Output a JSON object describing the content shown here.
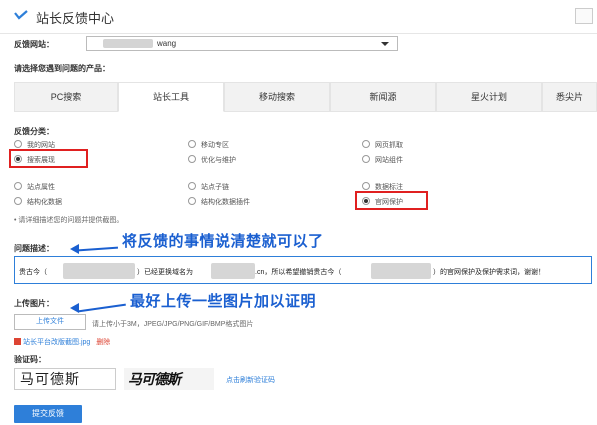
{
  "header": {
    "title": "站长反馈中心",
    "logo_icon": "check-chevron-icon"
  },
  "site": {
    "label": "反馈网站：",
    "value": "wang"
  },
  "product_prompt": "请选择您遇到问题的产品：",
  "tabs": [
    {
      "label": "PC搜索"
    },
    {
      "label": "站长工具"
    },
    {
      "label": "移动搜索"
    },
    {
      "label": "新闻源"
    },
    {
      "label": "星火计划"
    },
    {
      "label": "悉尖片"
    }
  ],
  "category": {
    "label": "反馈分类：",
    "options": [
      {
        "label": "我的网站"
      },
      {
        "label": "移动专区"
      },
      {
        "label": "网页抓取"
      },
      {
        "label": "搜索展现"
      },
      {
        "label": "优化与维护"
      },
      {
        "label": "网站组件"
      },
      {
        "label": "站点属性"
      },
      {
        "label": "站点子链"
      },
      {
        "label": "数据标注"
      },
      {
        "label": "结构化数据"
      },
      {
        "label": "结构化数据插件"
      },
      {
        "label": "官网保护"
      }
    ],
    "hint": "• 请详细描述您的问题并提供截图。"
  },
  "description": {
    "label": "问题描述：",
    "part1": "贵古今（",
    "part2": "）已经更换域名为",
    "part3": ".cn，所以希望撤销贵古今（",
    "part4": "）的官网保护及保护需求词，谢谢！"
  },
  "annotations": {
    "desc_note": "将反馈的事情说清楚就可以了",
    "upload_note": "最好上传一些图片加以证明"
  },
  "upload": {
    "label": "上传图片：",
    "button": "上传文件",
    "hint": "请上传小于3M，JPEG/JPG/PNG/GIF/BMP格式图片",
    "file_name": "站长平台改版截图.jpg",
    "delete": "删除"
  },
  "captcha": {
    "label": "验证码：",
    "value": "马可德斯",
    "image_text": "马可德斯",
    "refresh": "点击刷新验证码"
  },
  "submit": "提交反馈",
  "colors": {
    "accent": "#2e7fd9",
    "highlight": "#e02020",
    "annotation": "#1a5fd0"
  }
}
